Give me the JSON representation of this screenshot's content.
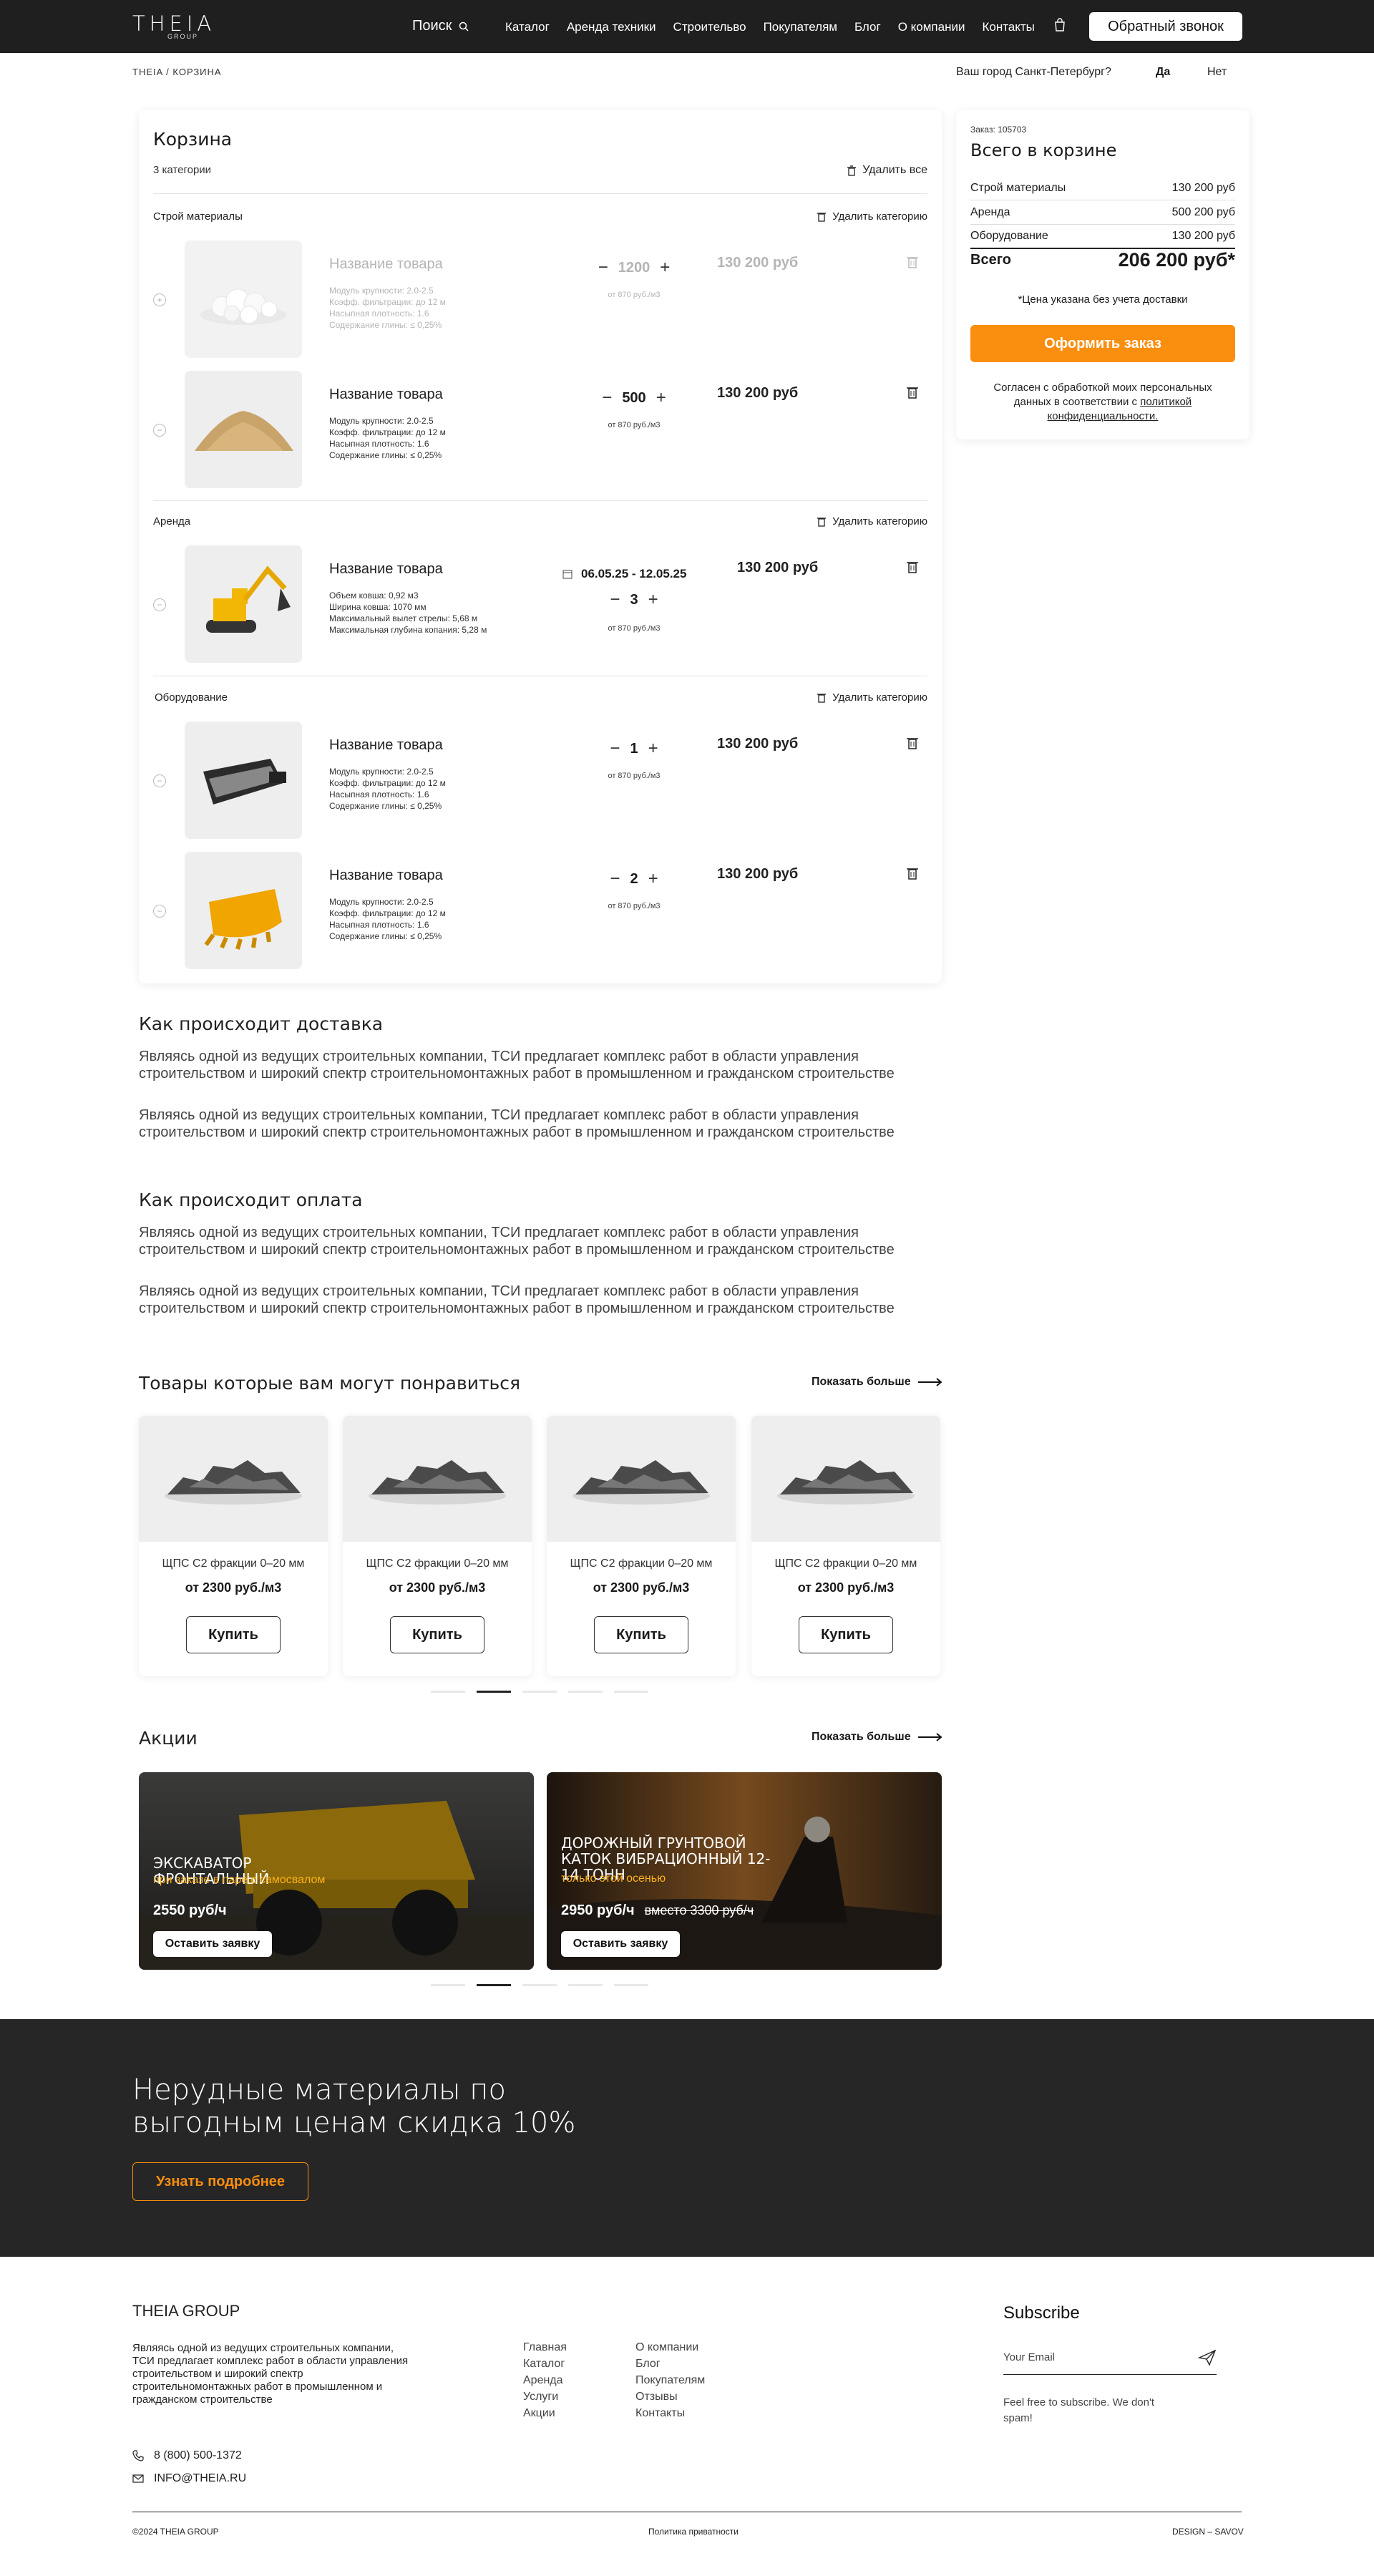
{
  "header": {
    "logo": "THEIA",
    "logo_sub": "GROUP",
    "search_label": "Поиск",
    "nav": [
      "Каталог",
      "Аренда техники",
      "Строительво",
      "Покупателям",
      "Блог",
      "О компании",
      "Контакты"
    ],
    "callback_label": "Обратный звонок"
  },
  "breadcrumb": "THEIA / КОРЗИНА",
  "city": {
    "question": "Ваш город Санкт-Петербург?",
    "yes": "Да",
    "no": "Нет"
  },
  "cart": {
    "title": "Корзина",
    "count": "3 категории",
    "delete_all": "Удалить все",
    "delete_category": "Удалить категорию",
    "categories": [
      {
        "name": "Строй материалы",
        "items": [
          {
            "name": "Название товара",
            "specs": [
              "Модуль крупности: 2.0-2.5",
              "Коэфф. фильтрации: до 12 м",
              "Насыпная плотность: 1.6",
              "Содержание глины: ≤ 0,25%"
            ],
            "qty": "1200",
            "note": "от 870 руб./м3",
            "price": "130 200 руб"
          },
          {
            "name": "Название товара",
            "specs": [
              "Модуль крупности: 2.0-2.5",
              "Коэфф. фильтрации: до 12 м",
              "Насыпная плотность: 1.6",
              "Содержание глины: ≤ 0,25%"
            ],
            "qty": "500",
            "note": "от 870 руб./м3",
            "price": "130 200 руб"
          }
        ]
      },
      {
        "name": "Аренда",
        "items": [
          {
            "name": "Название товара",
            "specs": [
              "Объем ковша: 0,92 м3",
              "Ширина ковша: 1070 мм",
              "Максимальный вылет стрелы: 5,68 м",
              "Максимальная глубина копания: 5,28 м"
            ],
            "dates": "06.05.25 - 12.05.25",
            "qty": "3",
            "note": "от 870 руб./м3",
            "price": "130 200 руб"
          }
        ]
      },
      {
        "name": "Оборудование",
        "items": [
          {
            "name": "Название товара",
            "specs": [
              "Модуль крупности: 2.0-2.5",
              "Коэфф. фильтрации: до 12 м",
              "Насыпная плотность: 1.6",
              "Содержание глины: ≤ 0,25%"
            ],
            "qty": "1",
            "note": "от 870 руб./м3",
            "price": "130 200 руб"
          },
          {
            "name": "Название товара",
            "specs": [
              "Модуль крупности: 2.0-2.5",
              "Коэфф. фильтрации: до 12 м",
              "Насыпная плотность: 1.6",
              "Содержание глины: ≤ 0,25%"
            ],
            "qty": "2",
            "note": "от 870 руб./м3",
            "price": "130 200 руб"
          }
        ]
      }
    ]
  },
  "summary": {
    "order": "Заказ: 105703",
    "title": "Всего в корзине",
    "rows": [
      {
        "label": "Строй материалы",
        "value": "130 200 руб"
      },
      {
        "label": "Аренда",
        "value": "500 200 руб"
      },
      {
        "label": "Оборудование",
        "value": "130 200 руб"
      }
    ],
    "total_label": "Всего",
    "total_value": "206 200 руб*",
    "note": "*Цена указана без учета доставки",
    "order_button": "Оформить заказ",
    "agree_text": "Согласен с обработкой моих персональных данных в соответствии с ",
    "agree_link": "политикой конфиденциальности."
  },
  "delivery": {
    "title": "Как происходит доставка",
    "p1": "Являясь одной из ведущих строительных компании, ТСИ предлагает комплекс работ в области управления строительством и широкий спектр строительномонтажных работ в промышленном и гражданском строительстве",
    "p2": "Являясь одной из ведущих строительных компании, ТСИ предлагает комплекс работ в области управления строительством и широкий спектр строительномонтажных работ в промышленном и гражданском строительстве"
  },
  "payment": {
    "title": "Как происходит оплата",
    "p1": "Являясь одной из ведущих строительных компании, ТСИ предлагает комплекс работ в области управления строительством и широкий спектр строительномонтажных работ в промышленном и гражданском строительстве",
    "p2": "Являясь одной из ведущих строительных компании, ТСИ предлагает комплекс работ в области управления строительством и широкий спектр строительномонтажных работ в промышленном и гражданском строительстве"
  },
  "recommended": {
    "title": "Товары которые вам могут понравиться",
    "more": "Показать больше",
    "items": [
      {
        "name": "ЩПС С2 фракции 0–20 мм",
        "price": "от 2300 руб./м3",
        "buy": "Купить"
      },
      {
        "name": "ЩПС С2 фракции 0–20 мм",
        "price": "от 2300 руб./м3",
        "buy": "Купить"
      },
      {
        "name": "ЩПС С2 фракции 0–20 мм",
        "price": "от 2300 руб./м3",
        "buy": "Купить"
      },
      {
        "name": "ЩПС С2 фракции 0–20 мм",
        "price": "от 2300 руб./м3",
        "buy": "Купить"
      }
    ]
  },
  "promos": {
    "title": "Акции",
    "more": "Показать больше",
    "items": [
      {
        "title": "ЭКСКАВАТОР ФРОНТАЛЬНЫЙ",
        "subtitle": "при заказе в паре с самосвалом",
        "price": "2550 руб/ч",
        "old": "",
        "button": "Оставить заявку"
      },
      {
        "title": "ДОРОЖНЫЙ ГРУНТОВОЙ КАТОК ВИБРАЦИОННЫЙ 12-14 ТОНН",
        "subtitle": "только этой осенью",
        "price": "2950 руб/ч",
        "old": "вместо 3300 руб/ч",
        "button": "Оставить заявку"
      }
    ]
  },
  "banner": {
    "title": "Нерудные материалы по выгодным ценам скидка 10%",
    "button": "Узнать подробнее"
  },
  "footer": {
    "brand": "THEIA GROUP",
    "description": "Являясь одной из ведущих строительных компании, ТСИ предлагает комплекс работ в области управления строительством и широкий спектр строительномонтажных работ в промышленном и гражданском строительстве",
    "links_col1": [
      "Главная",
      "Каталог",
      "Аренда",
      "Услуги",
      "Акции"
    ],
    "links_col2": [
      "О компании",
      "Блог",
      "Покупателям",
      "Отзывы",
      "Контакты"
    ],
    "subscribe_title": "Subscribe",
    "email_placeholder": "Your Email",
    "subscribe_note": "Feel free to subscribe. We don't spam!",
    "phone": "8 (800) 500-1372",
    "email": "INFO@THEIA.RU",
    "copyright": "©2024 THEIA GROUP",
    "privacy": "Политика приватности",
    "design": "DESIGN – SAVOV"
  },
  "colors": {
    "accent": "#f98e0f",
    "header_bg": "#1f1f1f",
    "banner_bg": "#262626"
  }
}
